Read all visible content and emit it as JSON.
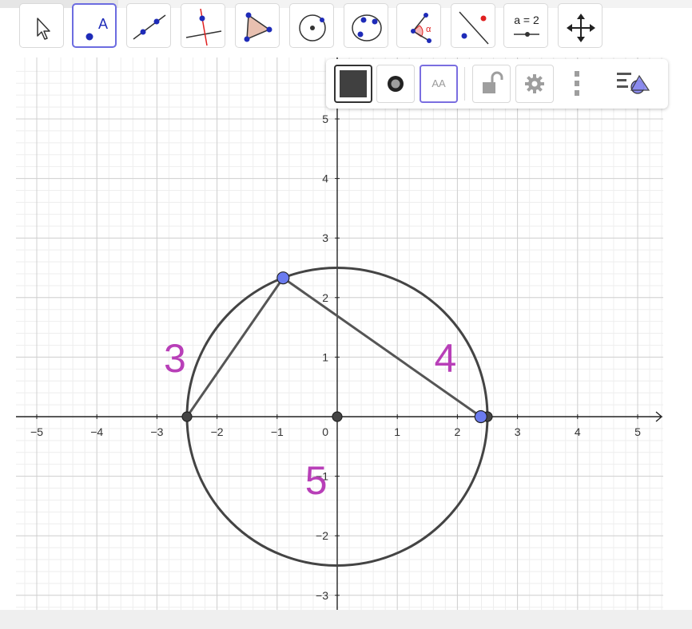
{
  "toolbar": {
    "tools": [
      {
        "name": "move-tool",
        "icon": "cursor-arrow-icon"
      },
      {
        "name": "point-tool",
        "icon": "point-a-icon",
        "label": "A",
        "active": true
      },
      {
        "name": "line-tool",
        "icon": "line-through-points-icon"
      },
      {
        "name": "perpendicular-line-tool",
        "icon": "perpendicular-line-icon"
      },
      {
        "name": "polygon-tool",
        "icon": "polygon-icon"
      },
      {
        "name": "circle-center-point-tool",
        "icon": "circle-center-icon"
      },
      {
        "name": "circle-three-points-tool",
        "icon": "circle-three-points-icon"
      },
      {
        "name": "angle-tool",
        "icon": "angle-icon",
        "label": "α"
      },
      {
        "name": "reflect-tool",
        "icon": "reflect-point-icon"
      },
      {
        "name": "slider-tool",
        "icon": "slider-icon",
        "label": "a = 2"
      },
      {
        "name": "move-graphics-tool",
        "icon": "move-arrows-icon"
      }
    ]
  },
  "stylebar": {
    "buttons": [
      {
        "name": "color-button",
        "icon": "color-swatch-icon",
        "color": "#404040"
      },
      {
        "name": "point-style-button",
        "icon": "point-style-icon"
      },
      {
        "name": "label-style-button",
        "icon": "label-aa-icon",
        "label": "AA"
      },
      {
        "name": "lock-button",
        "icon": "unlocked-lock-icon"
      },
      {
        "name": "settings-button",
        "icon": "gear-icon"
      },
      {
        "name": "more-button",
        "icon": "vertical-dots-icon"
      },
      {
        "name": "toggle-stylebar-button",
        "icon": "stylebar-toggle-icon"
      }
    ]
  },
  "graph": {
    "x_ticks": [
      "−5",
      "−4",
      "−3",
      "−2",
      "−1",
      "1",
      "2",
      "3",
      "4",
      "5"
    ],
    "y_ticks": [
      "5",
      "4",
      "3",
      "2",
      "1",
      "−1",
      "−2",
      "−3"
    ],
    "origin_label": "0",
    "circle": {
      "center": [
        0,
        0
      ],
      "radius": 2.5,
      "color": "#444444"
    },
    "triangle": {
      "vertices": [
        [
          -2.5,
          0
        ],
        [
          -0.9,
          2.33
        ],
        [
          2.39,
          0
        ]
      ],
      "color": "#555555"
    },
    "points": [
      {
        "name": "point-left",
        "x": -2.5,
        "y": 0,
        "style": "dark"
      },
      {
        "name": "point-origin",
        "x": 0,
        "y": 0,
        "style": "dark"
      },
      {
        "name": "point-right-intersection",
        "x": 2.5,
        "y": 0,
        "style": "dark"
      },
      {
        "name": "point-top",
        "x": -0.9,
        "y": 2.33,
        "style": "blue"
      },
      {
        "name": "point-right",
        "x": 2.39,
        "y": 0,
        "style": "blue"
      }
    ],
    "labels": [
      {
        "name": "side-label-3",
        "text": "3",
        "x": -2.7,
        "y": 0.75
      },
      {
        "name": "side-label-4",
        "text": "4",
        "x": 1.8,
        "y": 0.75
      },
      {
        "name": "side-label-5",
        "text": "5",
        "x": -0.35,
        "y": -1.3
      }
    ],
    "colors": {
      "label": "#b83fb8",
      "blue_point": "#6b7bef",
      "dark_point": "#444444"
    }
  }
}
